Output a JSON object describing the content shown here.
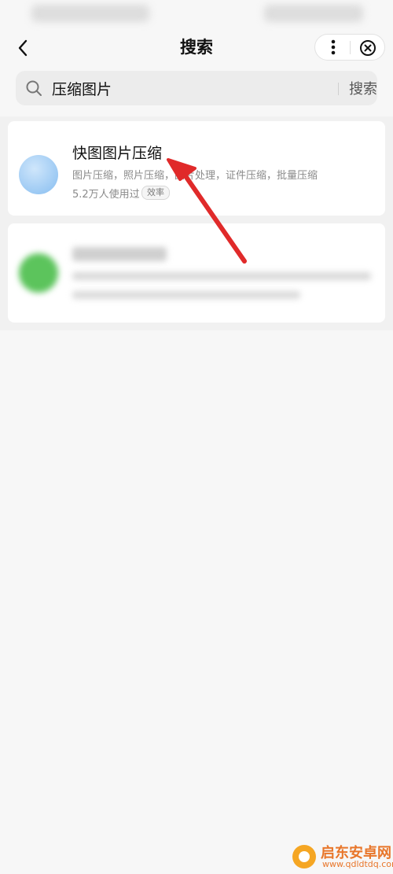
{
  "nav": {
    "title": "搜索"
  },
  "search": {
    "query": "压缩图片",
    "button_label": "搜索"
  },
  "results": [
    {
      "title": "快图图片压缩",
      "description": "图片压缩，照片压缩，图片处理，证件压缩，批量压缩",
      "users": "5.2万人使用过",
      "tag": "效率",
      "icon_color": "#8fc3f0"
    },
    {
      "title": "",
      "icon_color": "#5cc45c"
    }
  ],
  "watermark": {
    "name": "启东安卓网",
    "url": "www.qdldtdq.com"
  },
  "colors": {
    "arrow": "#e02a2a",
    "background": "#f7f7f7"
  }
}
